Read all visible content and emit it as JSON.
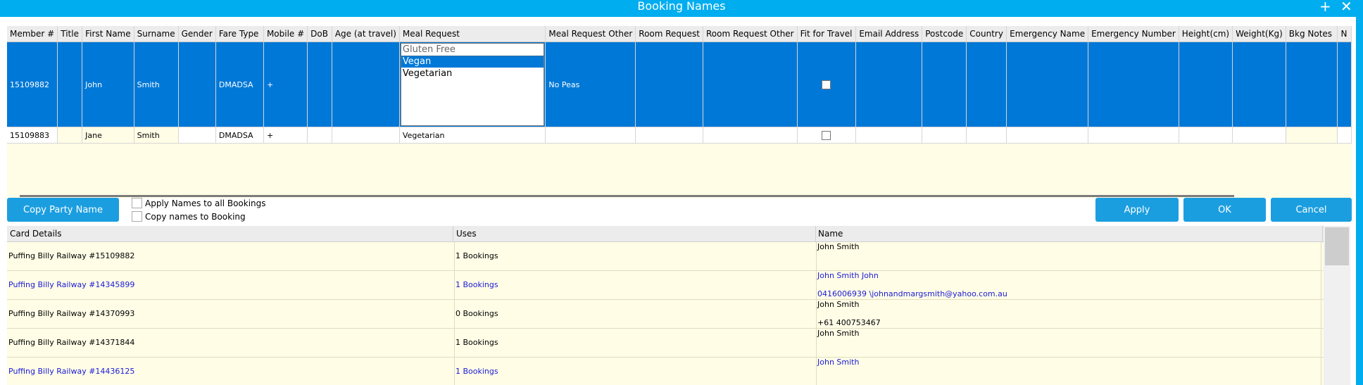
{
  "window": {
    "title": "Booking Names",
    "add_symbol": "+",
    "close_symbol": "✕"
  },
  "grid": {
    "columns": [
      "Member #",
      "Title",
      "First Name",
      "Surname",
      "Gender",
      "Fare Type",
      "Mobile #",
      "DoB",
      "Age (at travel)",
      "Meal Request",
      "Meal Request Other",
      "Room Request",
      "Room Request Other",
      "Fit for Travel",
      "Email Address",
      "Postcode",
      "Country",
      "Emergency Name",
      "Emergency Number",
      "Height(cm)",
      "Weight(Kg)",
      "Bkg Notes",
      "N"
    ],
    "meal_options": [
      "Gluten Free",
      "Vegan",
      "Vegetarian"
    ],
    "rows": [
      {
        "member": "15109882",
        "title": "",
        "first": "John",
        "surname": "Smith",
        "gender": "",
        "fare": "DMADSA",
        "mobile": "+",
        "meal": "",
        "meal_other": "No Peas"
      },
      {
        "member": "15109883",
        "title": "",
        "first": "Jane",
        "surname": "Smith",
        "gender": "",
        "fare": "DMADSA",
        "mobile": "+",
        "meal": "Vegetarian",
        "meal_other": ""
      }
    ]
  },
  "controls": {
    "copy_party_name": "Copy Party Name",
    "apply_all": "Apply Names to all Bookings",
    "copy_names": "Copy names to Booking",
    "apply": "Apply",
    "ok": "OK",
    "cancel": "Cancel"
  },
  "cards": {
    "headers": [
      "Card Details",
      "Uses",
      "Name"
    ],
    "rows": [
      {
        "details": "Puffing Billy Railway #15109882",
        "uses": "1 Bookings",
        "name": "John Smith",
        "extra": ""
      },
      {
        "details": "Puffing Billy Railway #14345899",
        "uses": "1 Bookings",
        "name": "John Smith John",
        "extra": "0416006939 \\johnandmargsmith@yahoo.com.au"
      },
      {
        "details": "Puffing Billy Railway #14370993",
        "uses": "0 Bookings",
        "name": "John Smith",
        "extra": "+61  400753467"
      },
      {
        "details": "Puffing Billy Railway #14371844",
        "uses": "1 Bookings",
        "name": "John Smith",
        "extra": ""
      },
      {
        "details": "Puffing Billy Railway #14436125",
        "uses": "1 Bookings",
        "name": "John Smith",
        "extra": ""
      }
    ]
  },
  "colors": {
    "title_bar": "#00adef",
    "selection": "#0078d7",
    "button": "#1b9ee0",
    "row_cream": "#fffde6",
    "link_blue": "#1a1ad6"
  }
}
